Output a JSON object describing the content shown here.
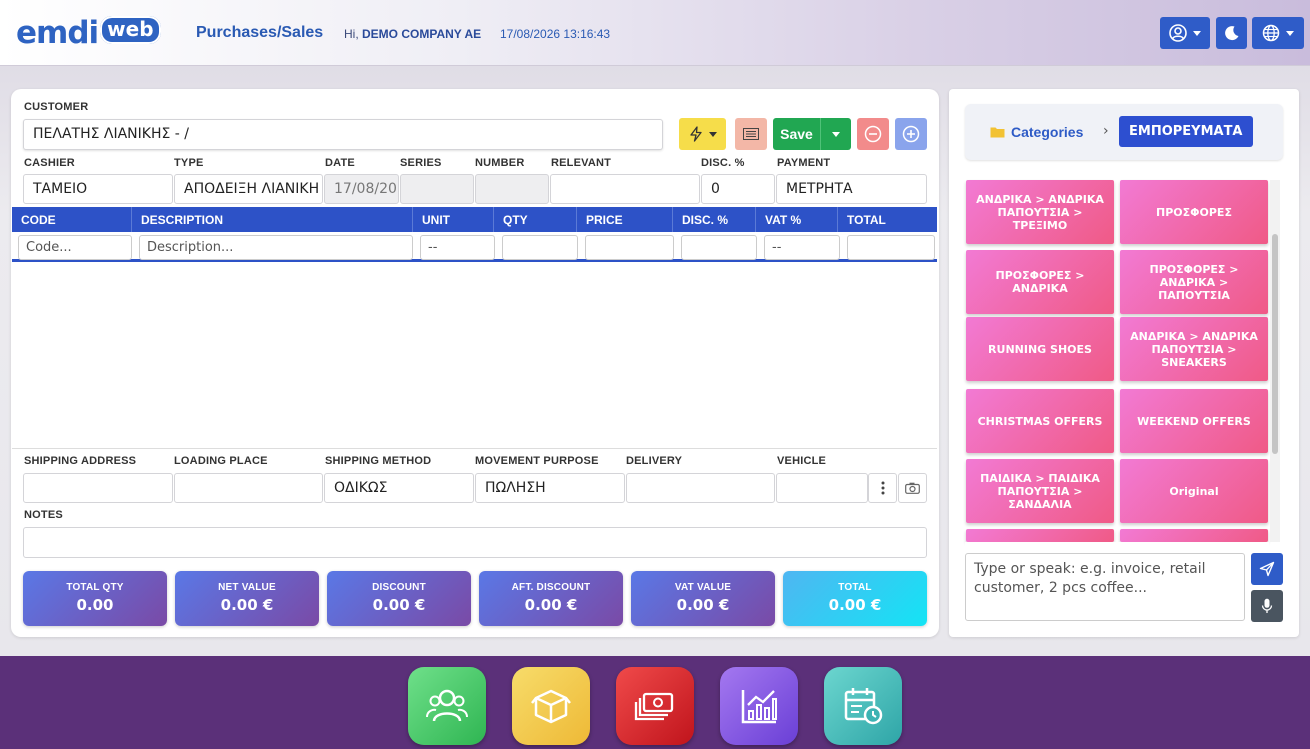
{
  "header": {
    "logo_main": "emdi",
    "logo_badge": "web",
    "title": "Purchases/Sales",
    "greeting_prefix": "Hi,",
    "company": "DEMO COMPANY AE",
    "datetime": "17/08/2026 13:16:43"
  },
  "customer": {
    "label": "CUSTOMER",
    "value": "ΠΕΛΑΤΗΣ ΛΙΑΝΙΚΗΣ - /"
  },
  "toolbar": {
    "save_label": "Save",
    "colors": {
      "action": "#f6dd4a",
      "notes": "#f3b7a7",
      "save": "#21a752",
      "remove": "#f28b8b",
      "add": "#8aa4ec"
    }
  },
  "doc_fields": {
    "cashier": {
      "label": "CASHIER",
      "value": "ΤΑΜΕΙΟ"
    },
    "type": {
      "label": "TYPE",
      "value": "ΑΠΟΔΕΙΞΗ ΛΙΑΝΙΚΗ"
    },
    "date": {
      "label": "DATE",
      "value": "17/08/20"
    },
    "series": {
      "label": "SERIES",
      "value": ""
    },
    "number": {
      "label": "NUMBER",
      "value": ""
    },
    "relevant": {
      "label": "RELEVANT",
      "value": ""
    },
    "disc": {
      "label": "DISC. %",
      "value": "0"
    },
    "payment": {
      "label": "PAYMENT",
      "value": "ΜΕΤΡΗΤΑ"
    }
  },
  "table": {
    "columns": [
      "CODE",
      "DESCRIPTION",
      "UNIT",
      "QTY",
      "PRICE",
      "DISC. %",
      "VAT %",
      "TOTAL"
    ],
    "entry": {
      "code_placeholder": "Code...",
      "description_placeholder": "Description...",
      "unit": "--",
      "vat": "--"
    }
  },
  "shipping": {
    "address": {
      "label": "SHIPPING ADDRESS",
      "value": ""
    },
    "loading": {
      "label": "LOADING PLACE",
      "value": ""
    },
    "method": {
      "label": "SHIPPING METHOD",
      "value": "ΟΔΙΚΩΣ"
    },
    "purpose": {
      "label": "MOVEMENT PURPOSE",
      "value": "ΠΩΛΗΣΗ"
    },
    "delivery": {
      "label": "DELIVERY",
      "value": ""
    },
    "vehicle": {
      "label": "VEHICLE",
      "value": ""
    }
  },
  "notes": {
    "label": "NOTES",
    "value": ""
  },
  "totals": [
    {
      "label": "TOTAL QTY",
      "value": "0.00"
    },
    {
      "label": "NET VALUE",
      "value": "0.00 €"
    },
    {
      "label": "DISCOUNT",
      "value": "0.00 €"
    },
    {
      "label": "AFT. DISCOUNT",
      "value": "0.00 €"
    },
    {
      "label": "VAT VALUE",
      "value": "0.00 €"
    },
    {
      "label": "TOTAL",
      "value": "0.00 €"
    }
  ],
  "categories": {
    "root_label": "Categories",
    "current": "ΕΜΠΟΡΕΥΜΑΤΑ",
    "tiles": [
      "ΑΝΔΡΙΚΑ > ΑΝΔΡΙΚΑ ΠΑΠΟΥΤΣΙΑ > ΤΡΕΞΙΜΟ",
      "ΠΡΟΣΦΟΡΕΣ",
      "ΠΡΟΣΦΟΡΕΣ > ΑΝΔΡΙΚΑ",
      "ΠΡΟΣΦΟΡΕΣ > ΑΝΔΡΙΚΑ > ΠΑΠΟΥΤΣΙΑ",
      "RUNNING SHOES",
      "ΑΝΔΡΙΚΑ > ΑΝΔΡΙΚΑ ΠΑΠΟΥΤΣΙΑ > SNEAKERS",
      "CHRISTMAS OFFERS",
      "WEEKEND OFFERS",
      "ΠΑΙΔΙΚΑ > ΠΑΙΔΙΚΑ ΠΑΠΟΥΤΣΙΑ > ΣΑΝΔΑΛΙΑ",
      "Original"
    ]
  },
  "assistant": {
    "placeholder": "Type or speak: e.g. invoice, retail customer, 2 pcs coffee..."
  },
  "dock": [
    {
      "icon": "users-icon",
      "color": "#4cc96a"
    },
    {
      "icon": "box-icon",
      "color": "#f2c53d"
    },
    {
      "icon": "money-icon",
      "color": "#d9252c"
    },
    {
      "icon": "chart-icon",
      "color": "#7a4ee0"
    },
    {
      "icon": "calendar-clock-icon",
      "color": "#3fb7b3"
    }
  ]
}
